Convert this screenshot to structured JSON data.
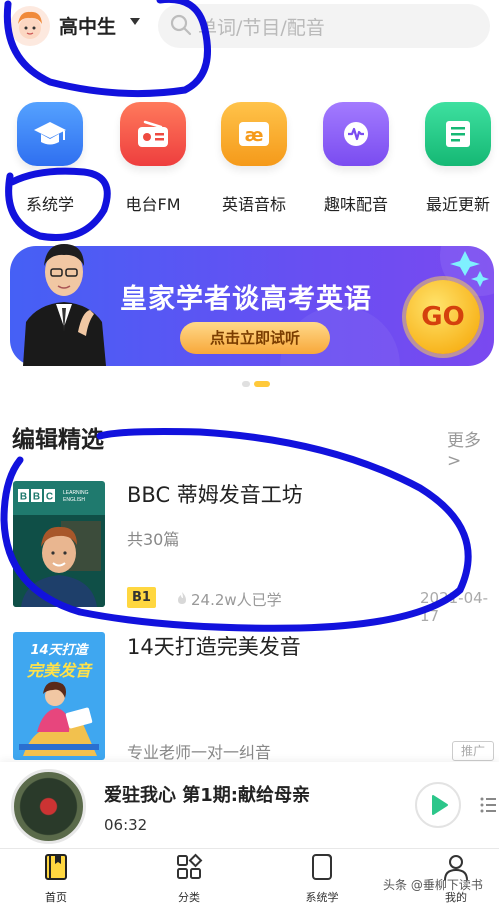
{
  "header": {
    "grade_label": "高中生",
    "search_placeholder": "单词/节目/配音"
  },
  "categories": [
    {
      "label": "系统学",
      "icon": "graduation-cap-icon",
      "color": "#3b82f6"
    },
    {
      "label": "电台FM",
      "icon": "radio-icon",
      "color": "#f2554a"
    },
    {
      "label": "英语音标",
      "icon": "phonetic-ae-icon",
      "color": "#f5a623"
    },
    {
      "label": "趣味配音",
      "icon": "voice-wave-icon",
      "color": "#8b5cf6"
    },
    {
      "label": "最近更新",
      "icon": "document-icon",
      "color": "#2cc68a"
    }
  ],
  "banner": {
    "title": "皇家学者谈高考英语",
    "button_label": "点击立即试听",
    "go_label": "GO",
    "page_count": 2,
    "active_page": 2
  },
  "section": {
    "title": "编辑精选",
    "more_label": "更多 >"
  },
  "courses": [
    {
      "title": "BBC 蒂姆发音工坊",
      "subtitle": "共30篇",
      "level": "B1",
      "learners": "24.2w人已学",
      "date": "2021-04-17",
      "cover_text_1": "BBC",
      "cover_text_2": "LEARNING ENGLISH"
    },
    {
      "title": "14天打造完美发音",
      "subtitle": "专业老师一对一纠音",
      "tag": "推广",
      "cover_text": "14天打造完美发音"
    }
  ],
  "player": {
    "title": "爱驻我心 第1期:献给母亲",
    "time": "06:32"
  },
  "tabs": [
    {
      "label": "首页",
      "icon": "book-icon"
    },
    {
      "label": "分类",
      "icon": "grid-icon"
    },
    {
      "label": "系统学",
      "icon": "notebook-icon"
    },
    {
      "label": "我的",
      "icon": "person-icon"
    }
  ],
  "watermark": "头条 @垂柳下读书",
  "colors": {
    "accent": "#f5a623",
    "banner": "#5a55f2",
    "annotation": "#1010dd"
  }
}
